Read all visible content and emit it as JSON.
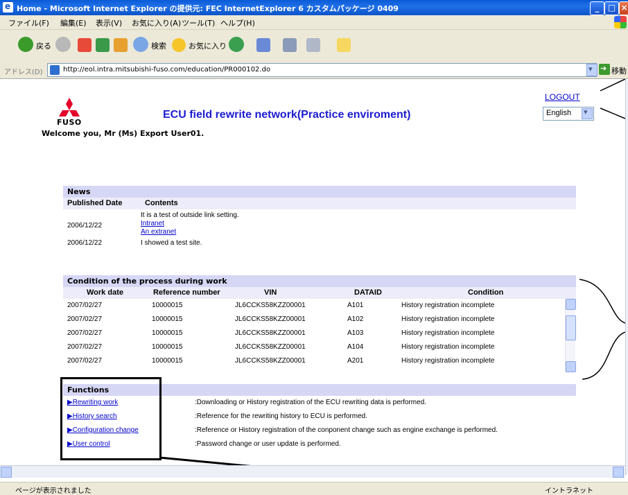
{
  "window": {
    "title": "Home - Microsoft Internet Explorer の提供元: FEC InternetExplorer 6 カスタムパッケージ 0409"
  },
  "menu": [
    "ファイル(F)",
    "編集(E)",
    "表示(V)",
    "お気に入り(A)",
    "ツール(T)",
    "ヘルプ(H)"
  ],
  "toolbar": {
    "back_label": "戻る",
    "search_label": "検索",
    "favorites_label": "お気に入り"
  },
  "address": {
    "label": "アドレス(D)",
    "url": "http://eol.intra.mitsubishi-fuso.com/education/PR000102.do",
    "go_label": "移動"
  },
  "page": {
    "logo_text": "FUSO",
    "title": "ECU field rewrite network(Practice enviroment)",
    "logout": "LOGOUT",
    "language": "English",
    "welcome": "Welcome you, Mr (Ms) Export User01."
  },
  "news": {
    "heading": "News",
    "columns": [
      "Published Date",
      "Contents"
    ],
    "item1_date": "2006/12/22",
    "item1_text": "It is a test of outside link setting.",
    "item1_link1": "Intranet",
    "item1_link2": "An extranet",
    "item2_date": "2006/12/22",
    "item2_text": "I showed a test site."
  },
  "process": {
    "heading": "Condition of the process during work",
    "columns": [
      "Work date",
      "Reference number",
      "VIN",
      "DATAID",
      "Condition"
    ],
    "rows": [
      [
        "2007/02/27",
        "10000015",
        "JL6CCKS58KZZ00001",
        "A101",
        "History registration incomplete"
      ],
      [
        "2007/02/27",
        "10000015",
        "JL6CCKS58KZZ00001",
        "A102",
        "History registration incomplete"
      ],
      [
        "2007/02/27",
        "10000015",
        "JL6CCKS58KZZ00001",
        "A103",
        "History registration incomplete"
      ],
      [
        "2007/02/27",
        "10000015",
        "JL6CCKS58KZZ00001",
        "A104",
        "History registration incomplete"
      ],
      [
        "2007/02/27",
        "10000015",
        "JL6CCKS58KZZ00001",
        "A201",
        "History registration incomplete"
      ]
    ]
  },
  "functions": {
    "heading": "Functions",
    "items": [
      {
        "link": "▶Rewriting work",
        "desc": ":Downloading or History registration of the ECU rewriting data is performed."
      },
      {
        "link": "▶History search",
        "desc": ":Reference for the rewriting history to ECU is performed."
      },
      {
        "link": "▶Configuration change",
        "desc": ":Reference or History registration of the conponent change such as engine exchange is performed."
      },
      {
        "link": "▶User control",
        "desc": ":Password change or user update is performed."
      }
    ]
  },
  "status": {
    "text": "ページが表示されました",
    "zone": "イントラネット"
  },
  "colors": {
    "title_blue": "#1c1cd0",
    "section_bg": "#d6d6f5",
    "link": "#0000cc",
    "logo_red": "#e4002b"
  }
}
